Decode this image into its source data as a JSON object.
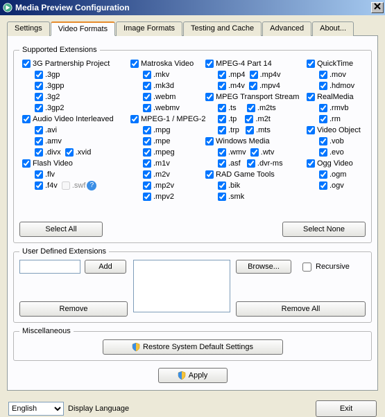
{
  "window": {
    "title": "Media Preview Configuration",
    "close": "X"
  },
  "tabs": {
    "settings": "Settings",
    "video_formats": "Video Formats",
    "image_formats": "Image Formats",
    "testing_cache": "Testing and Cache",
    "advanced": "Advanced",
    "about": "About..."
  },
  "supported": {
    "legend": "Supported Extensions",
    "h_3gp": "3G Partnership Project",
    "e_3gp": ".3gp",
    "e_3gpp": ".3gpp",
    "e_3g2": ".3g2",
    "e_3gp2": ".3gp2",
    "h_avi": "Audio Video Interleaved",
    "e_avi": ".avi",
    "e_amv": ".amv",
    "e_divx": ".divx",
    "e_xvid": ".xvid",
    "h_flash": "Flash Video",
    "e_flv": ".flv",
    "e_f4v": ".f4v",
    "e_swf": ".swf",
    "h_mkv": "Matroska Video",
    "e_mkv": ".mkv",
    "e_mk3d": ".mk3d",
    "e_webm": ".webm",
    "e_webmv": ".webmv",
    "h_mpeg": "MPEG-1 / MPEG-2",
    "e_mpg": ".mpg",
    "e_mpe": ".mpe",
    "e_mpeg": ".mpeg",
    "e_m1v": ".m1v",
    "e_m2v": ".m2v",
    "e_mp2v": ".mp2v",
    "e_mpv2": ".mpv2",
    "h_mp4": "MPEG-4 Part 14",
    "e_mp4": ".mp4",
    "e_mp4v": ".mp4v",
    "e_m4v": ".m4v",
    "e_mpv4": ".mpv4",
    "h_ts": "MPEG Transport Stream",
    "e_ts": ".ts",
    "e_m2ts": ".m2ts",
    "e_tp": ".tp",
    "e_m2t": ".m2t",
    "e_trp": ".trp",
    "e_mts": ".mts",
    "h_wm": "Windows Media",
    "e_wmv": ".wmv",
    "e_wtv": ".wtv",
    "e_asf": ".asf",
    "e_dvrms": ".dvr-ms",
    "h_rad": "RAD Game Tools",
    "e_bik": ".bik",
    "e_smk": ".smk",
    "h_qt": "QuickTime",
    "e_mov": ".mov",
    "e_hdmov": ".hdmov",
    "h_real": "RealMedia",
    "e_rmvb": ".rmvb",
    "e_rm": ".rm",
    "h_vob": "Video Object",
    "e_vob": ".vob",
    "e_evo": ".evo",
    "h_ogg": "Ogg Video",
    "e_ogm": ".ogm",
    "e_ogv": ".ogv",
    "select_all": "Select All",
    "select_none": "Select None"
  },
  "ude": {
    "legend": "User Defined Extensions",
    "add": "Add",
    "remove": "Remove",
    "browse": "Browse...",
    "recursive": "Recursive",
    "remove_all": "Remove All"
  },
  "misc": {
    "legend": "Miscellaneous",
    "restore": "Restore System Default Settings",
    "apply": "Apply"
  },
  "footer": {
    "language": "English",
    "language_label": "Display Language",
    "exit": "Exit"
  }
}
